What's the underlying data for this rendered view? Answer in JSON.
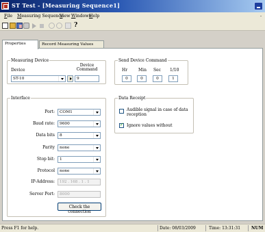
{
  "window": {
    "title": "ST Test - [Measuring Sequence1]"
  },
  "menu": {
    "items": [
      "File",
      "Measuring Sequence",
      "View",
      "Windows",
      "Help"
    ],
    "underline": [
      "F",
      "M",
      "V",
      "W",
      "H"
    ]
  },
  "toolbar": {
    "icons": [
      "new-icon",
      "open-icon",
      "copy-icon",
      "print-icon",
      "play-icon",
      "stop-icon",
      "circle-icon",
      "circle-icon",
      "document-icon",
      "help-icon"
    ],
    "help_glyph": "?"
  },
  "tabs": [
    "Properties",
    "Record Measuring Values"
  ],
  "measuring_device": {
    "title": "Measuring Device",
    "device_label": "Device",
    "command_label": "Device Command",
    "device_value": "ST-10",
    "command_value": "9"
  },
  "send_command": {
    "title": "Send Device Command",
    "columns": [
      "Hr",
      "Min",
      "Sec",
      "1/10"
    ],
    "values": [
      "0",
      "0",
      "0",
      "1"
    ]
  },
  "interface": {
    "title": "Interface",
    "rows": [
      {
        "label": "Port:",
        "value": "COM1"
      },
      {
        "label": "Baud rate:",
        "value": "9600"
      },
      {
        "label": "Data bits",
        "value": "8"
      },
      {
        "label": "Parity",
        "value": "none"
      },
      {
        "label": "Stop bit:",
        "value": "1"
      },
      {
        "label": "Protocol",
        "value": "none"
      }
    ],
    "ip_label": "IP-Address:",
    "ip_octets": [
      "192",
      "168",
      "1",
      "1"
    ],
    "server_port_label": "Server Port:",
    "server_port_value": "8000",
    "check_button": "Check the connection"
  },
  "data_receipt": {
    "title": "Data Receipt",
    "audible_label": "Audible signal in case of data reception",
    "audible_checked": false,
    "ignore_label": "Ignore values without",
    "ignore_checked": true
  },
  "status": {
    "help_text": "Press F1 for help.",
    "date": "Date: 08/03/2009",
    "time": "Time: 13:31:31",
    "num": "NUM"
  }
}
